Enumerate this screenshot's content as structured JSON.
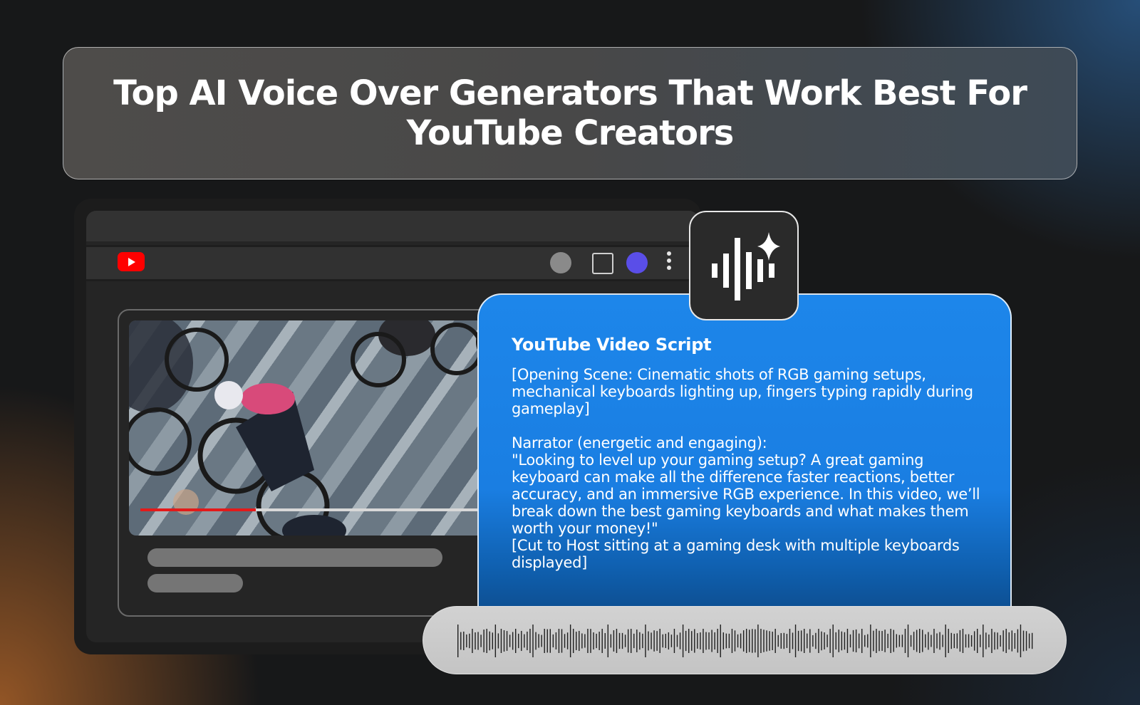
{
  "banner": {
    "title": "Top AI Voice Over Generators That Work Best For\nYouTube Creators"
  },
  "browser": {
    "logo_icon": "youtube-logo-icon",
    "nav_icons": [
      "profile-circle-icon",
      "square-icon",
      "avatar-circle-icon",
      "kebab-menu-icon"
    ],
    "video": {
      "progress_fraction": 0.29,
      "progress_color": "#e31a1a"
    }
  },
  "script": {
    "title": "YouTube Video Script",
    "opening": "[Opening Scene: Cinematic shots of RGB gaming setups, mechanical keyboards lighting up, fingers typing rapidly during gameplay]",
    "narrator_label": "Narrator (energetic and engaging):",
    "narration": "\"Looking to level up your gaming setup? A great gaming keyboard can make all the difference faster reactions, better accuracy, and an immersive RGB experience. In this video, we’ll break down the best gaming keyboards and what makes them worth your money!\"",
    "cut": "[Cut to Host sitting at a gaming desk with multiple keyboards displayed]"
  },
  "ai_badge": {
    "icon": "ai-voice-sparkle-icon"
  },
  "waveform": {
    "icon": "audio-waveform-icon"
  },
  "colors": {
    "youtube_red": "#ff0000",
    "script_blue": "#1d86ea",
    "avatar_purple": "#5a4ee8"
  }
}
